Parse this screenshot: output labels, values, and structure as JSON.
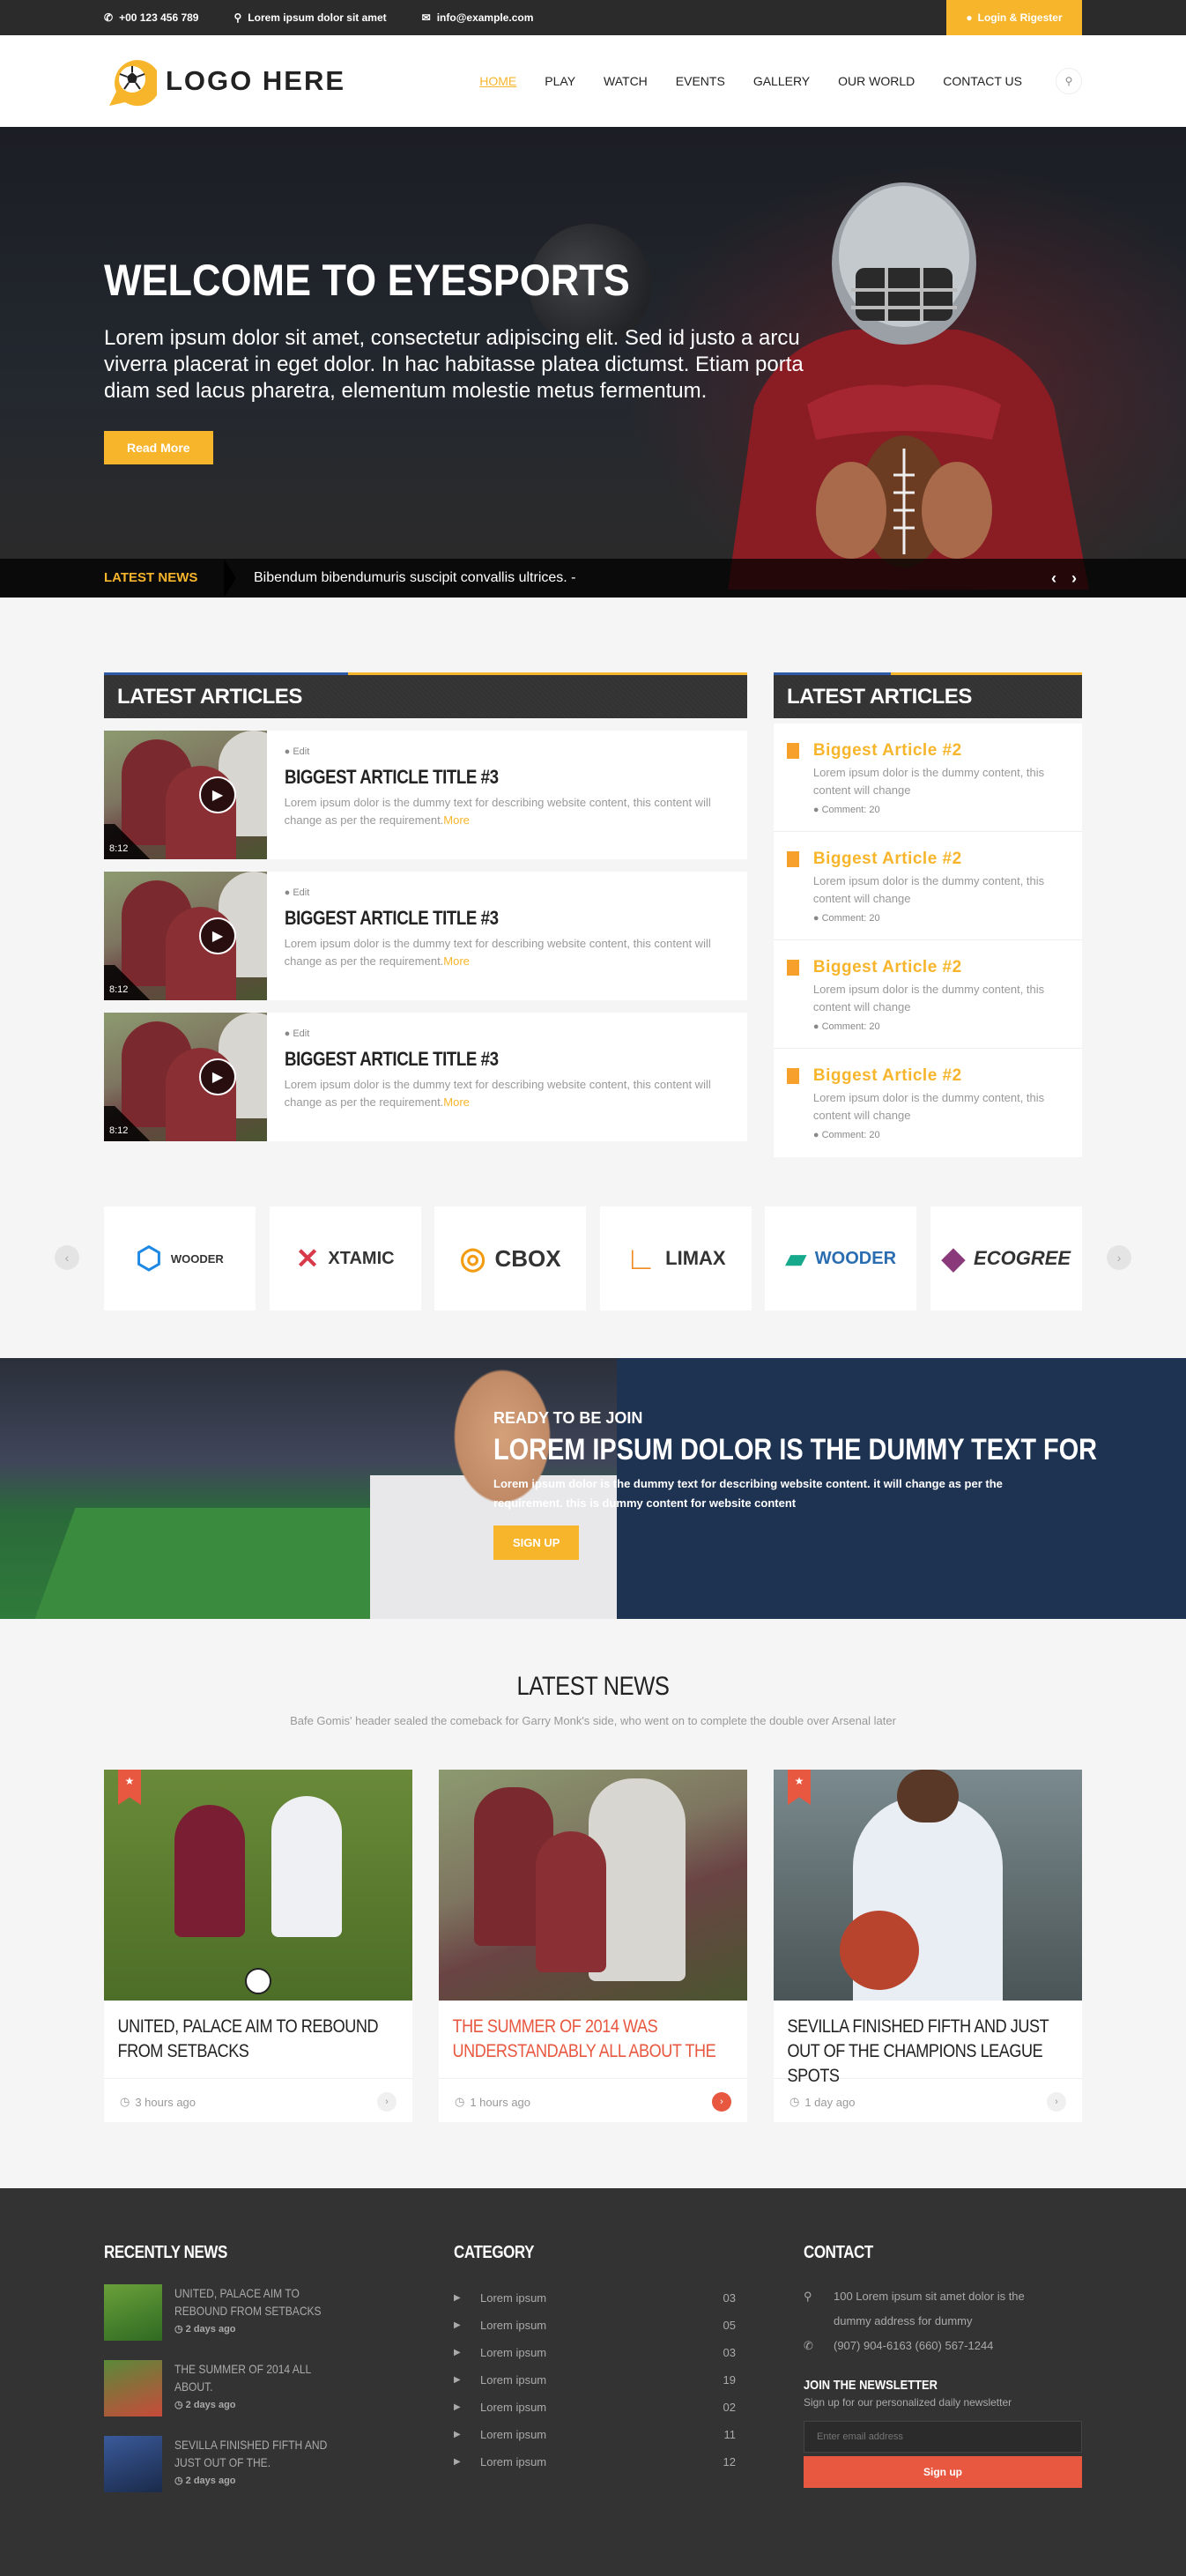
{
  "topbar": {
    "phone": "+00 123 456 789",
    "address": "Lorem ipsum dolor sit amet",
    "email": "info@example.com",
    "login": "Login & Rigester"
  },
  "header": {
    "logo_text": "LOGO HERE",
    "nav": [
      "HOME",
      "PLAY",
      "WATCH",
      "EVENTS",
      "GALLERY",
      "OUR WORLD",
      "CONTACT US"
    ],
    "active": "HOME"
  },
  "hero": {
    "title": "WELCOME TO EYESPORTS",
    "text": "Lorem ipsum dolor sit amet, consectetur adipiscing elit. Sed id justo a arcu viverra placerat in eget dolor. In hac habitasse platea dictumst. Etiam porta diam sed lacus pharetra, elementum molestie metus fermentum.",
    "button": "Read More"
  },
  "ticker": {
    "label": "LATEST NEWS",
    "text": "Bibendum bibendumuris suscipit convallis ultrices. -",
    "arrows": "‹ ›"
  },
  "articles_left": {
    "heading": "LATEST ARTICLES",
    "items": [
      {
        "edit": "Edit",
        "title": "BIGGEST ARTICLE TITLE #3",
        "desc": "Lorem ipsum dolor is the dummy text for describing website content, this content will change as per the requirement.",
        "more": "More",
        "duration": "8:12"
      },
      {
        "edit": "Edit",
        "title": "BIGGEST ARTICLE TITLE #3",
        "desc": "Lorem ipsum dolor is the dummy text for describing website content, this content will change as per the requirement.",
        "more": "More",
        "duration": "8:12"
      },
      {
        "edit": "Edit",
        "title": "BIGGEST ARTICLE TITLE #3",
        "desc": "Lorem ipsum dolor is the dummy text for describing website content, this content will change as per the requirement.",
        "more": "More",
        "duration": "8:12"
      }
    ]
  },
  "articles_right": {
    "heading": "LATEST ARTICLES",
    "items": [
      {
        "title": "Biggest Article #2",
        "desc": "Lorem ipsum dolor is the dummy content, this content will change",
        "comment_label": "Comment:",
        "comment_count": "20"
      },
      {
        "title": "Biggest Article #2",
        "desc": "Lorem ipsum dolor is the dummy content, this content will change",
        "comment_label": "Comment:",
        "comment_count": "20"
      },
      {
        "title": "Biggest Article #2",
        "desc": "Lorem ipsum dolor is the dummy content, this content will change",
        "comment_label": "Comment:",
        "comment_count": "20"
      },
      {
        "title": "Biggest Article #2",
        "desc": "Lorem ipsum dolor is the dummy content, this content will change",
        "comment_label": "Comment:",
        "comment_count": "20"
      }
    ]
  },
  "brands": [
    "WOODER",
    "XTAMIC",
    "CBOX",
    "LIMAX",
    "WOODER",
    "ECOGREE"
  ],
  "join": {
    "kicker": "READY TO BE JOIN",
    "title": "LOREM IPSUM DOLOR IS THE DUMMY TEXT FOR",
    "text": "Lorem ipsum dolor is the dummy text for describing website content. it will change as per the requirement. this is dummy content for website content",
    "button": "SIGN UP"
  },
  "news": {
    "title": "LATEST NEWS",
    "subtitle": "Bafe Gomis' header sealed the comeback for Garry Monk's side, who went on to complete the double over Arsenal later",
    "cards": [
      {
        "title": "UNITED, PALACE AIM TO REBOUND FROM SETBACKS",
        "time": "3 hours ago"
      },
      {
        "title": "THE SUMMER OF 2014 WAS UNDERSTANDABLY ALL ABOUT THE",
        "time": "1 hours ago"
      },
      {
        "title": "SEVILLA FINISHED FIFTH AND JUST OUT OF THE CHAMPIONS LEAGUE SPOTS",
        "time": "1 day ago"
      }
    ]
  },
  "footer": {
    "recent_heading": "RECENTLY NEWS",
    "recent": [
      {
        "title": "UNITED, PALACE AIM TO REBOUND FROM SETBACKS",
        "date": "2 days ago"
      },
      {
        "title": "THE SUMMER OF 2014 ALL ABOUT.",
        "date": "2 days ago"
      },
      {
        "title": "SEVILLA FINISHED FIFTH AND JUST OUT OF THE.",
        "date": "2 days ago"
      }
    ],
    "category_heading": "CATEGORY",
    "categories": [
      {
        "label": "Lorem ipsum",
        "count": "03"
      },
      {
        "label": "Lorem ipsum",
        "count": "05"
      },
      {
        "label": "Lorem ipsum",
        "count": "03"
      },
      {
        "label": "Lorem ipsum",
        "count": "19"
      },
      {
        "label": "Lorem ipsum",
        "count": "02"
      },
      {
        "label": "Lorem ipsum",
        "count": "11"
      },
      {
        "label": "Lorem ipsum",
        "count": "12"
      }
    ],
    "contact_heading": "CONTACT",
    "address": "100 Lorem ipsum sit amet dolor is the dummy address for dummy",
    "phone": "(907) 904-6163 (660) 567-1244",
    "newsletter_heading": "JOIN THE NEWSLETTER",
    "newsletter_sub": "Sign up for our personalized daily newsletter",
    "email_placeholder": "Enter email address",
    "signup": "Sign up"
  },
  "colors": {
    "accent": "#f7b52c",
    "red": "#e8573f",
    "dark": "#333333"
  }
}
